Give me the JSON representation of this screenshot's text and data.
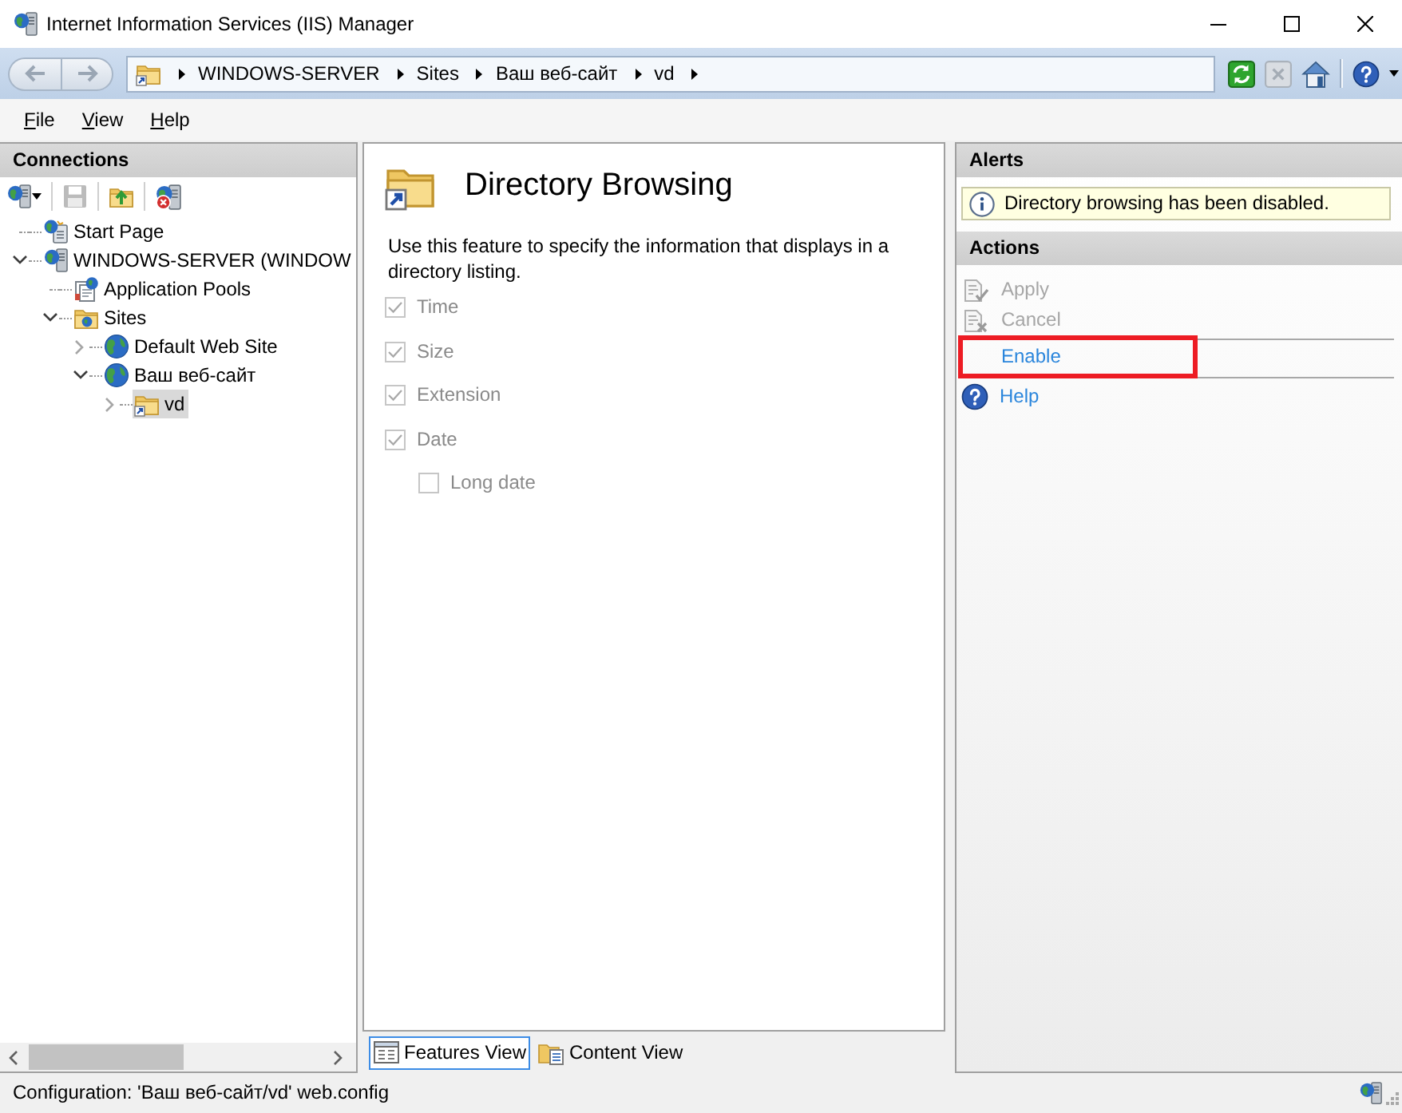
{
  "window": {
    "title": "Internet Information Services (IIS) Manager"
  },
  "nav_buttons": [
    {
      "kind": "back",
      "disabled": true
    },
    {
      "kind": "forward",
      "disabled": true
    }
  ],
  "breadcrumb": [
    "WINDOWS-SERVER",
    "Sites",
    "Ваш веб-сайт",
    "vd"
  ],
  "toolbar": [
    {
      "kind": "refresh",
      "disabled": false
    },
    {
      "kind": "stop",
      "disabled": true
    },
    {
      "kind": "home",
      "disabled": false
    },
    {
      "kind": "help",
      "disabled": false
    }
  ],
  "menu": [
    "File",
    "View",
    "Help"
  ],
  "connections": {
    "title": "Connections",
    "toolbar": [
      {
        "kind": "connect",
        "disabled": false
      },
      {
        "kind": "save",
        "disabled": true
      },
      {
        "kind": "up",
        "disabled": false
      },
      {
        "kind": "disconnect",
        "disabled": false
      }
    ],
    "tree": [
      {
        "label": "Start Page",
        "kind": "start",
        "selected": false
      },
      {
        "label": "WINDOWS-SERVER (WINDOW",
        "kind": "server",
        "expanded": true,
        "selected": false,
        "children": [
          {
            "label": "Application Pools",
            "kind": "app_pools",
            "selected": false
          },
          {
            "label": "Sites",
            "kind": "sites",
            "expanded": true,
            "selected": false,
            "children": [
              {
                "label": "Default Web Site",
                "kind": "site",
                "expanded": false,
                "selected": false
              },
              {
                "label": "Ваш веб-сайт",
                "kind": "site",
                "expanded": true,
                "selected": false,
                "children": [
                  {
                    "label": "vd",
                    "kind": "folder",
                    "expanded": false,
                    "selected": true
                  }
                ]
              }
            ]
          }
        ]
      }
    ]
  },
  "feature": {
    "title": "Directory Browsing",
    "description": "Use this feature to specify the information that displays in a directory listing.",
    "options": [
      {
        "label": "Time",
        "checked": true,
        "disabled": true
      },
      {
        "label": "Size",
        "checked": true,
        "disabled": true
      },
      {
        "label": "Extension",
        "checked": true,
        "disabled": true
      },
      {
        "label": "Date",
        "checked": true,
        "disabled": true,
        "children": [
          {
            "label": "Long date",
            "checked": false,
            "disabled": true
          }
        ]
      }
    ]
  },
  "view_tabs": [
    {
      "label": "Features View",
      "kind": "features",
      "selected": true
    },
    {
      "label": "Content View",
      "kind": "content",
      "selected": false
    }
  ],
  "alerts": {
    "title": "Alerts",
    "messages": [
      "Directory browsing has been disabled."
    ]
  },
  "actions": {
    "title": "Actions",
    "groups": [
      {
        "items": [
          {
            "label": "Apply",
            "kind": "apply",
            "disabled": true,
            "highlighted": false
          },
          {
            "label": "Cancel",
            "kind": "cancel",
            "disabled": true,
            "highlighted": false
          }
        ]
      },
      {
        "items": [
          {
            "label": "Enable",
            "kind": "link",
            "disabled": false,
            "highlighted": true
          }
        ]
      },
      {
        "items": [
          {
            "label": "Help",
            "kind": "help",
            "disabled": false,
            "highlighted": false
          }
        ]
      }
    ]
  },
  "status_bar": {
    "text": "Configuration: 'Ваш веб-сайт/vd' web.config"
  }
}
